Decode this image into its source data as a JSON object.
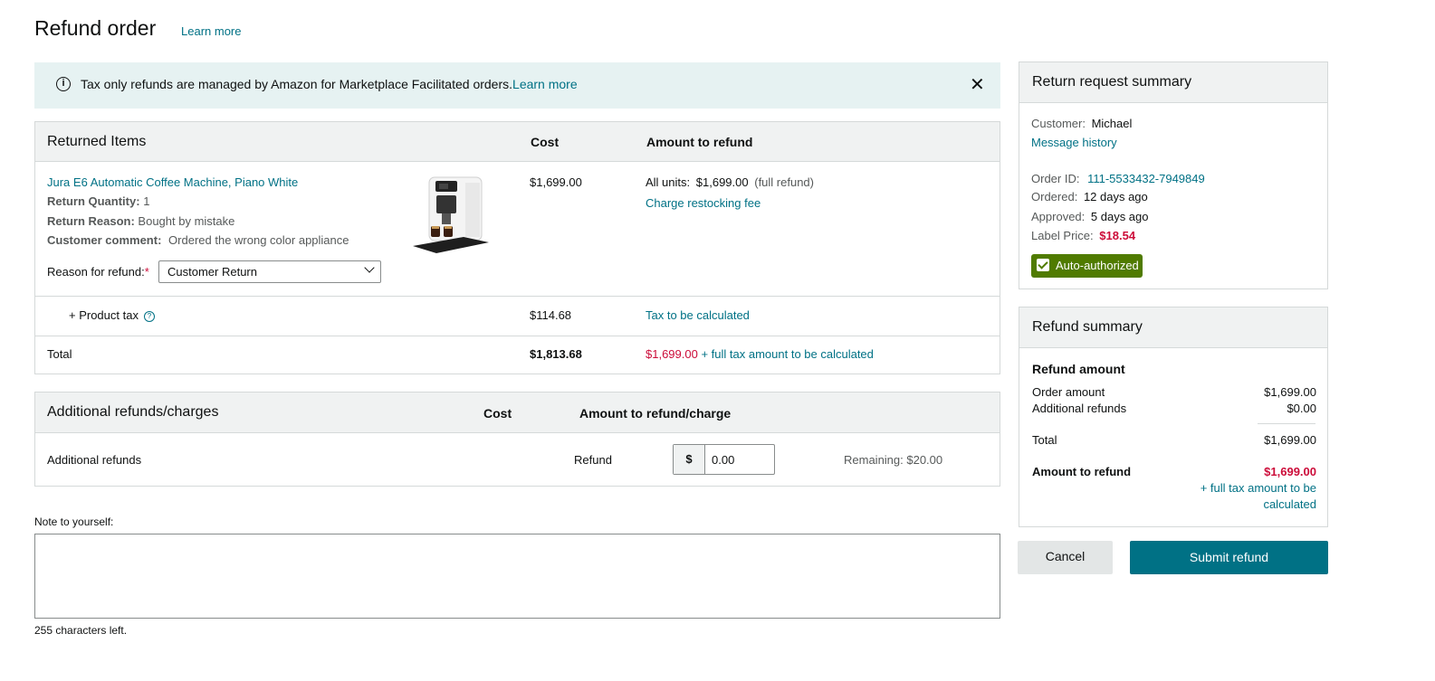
{
  "header": {
    "title": "Refund order",
    "learn_more": "Learn more"
  },
  "banner": {
    "message": "Tax only refunds are managed by Amazon for Marketplace Facilitated orders.",
    "link": "Learn more",
    "close": "✕"
  },
  "returned_items": {
    "title": "Returned Items",
    "col_cost": "Cost",
    "col_amount": "Amount to refund",
    "item": {
      "name": "Jura E6 Automatic Coffee Machine, Piano White",
      "qty_label": "Return Quantity:",
      "qty": "1",
      "reason_label": "Return Reason:",
      "reason": "Bought by mistake",
      "comment_label": "Customer comment:",
      "comment": "Ordered the wrong color appliance",
      "refund_reason_label": "Reason for refund:",
      "required_mark": "*",
      "refund_reason_value": "Customer Return",
      "cost": "$1,699.00",
      "all_units_label": "All units:",
      "all_units_value": "$1,699.00",
      "full_refund": "(full refund)",
      "restocking": "Charge restocking fee"
    },
    "tax": {
      "label": "+ Product tax",
      "cost": "$114.68",
      "amount": "Tax to be calculated"
    },
    "total": {
      "label": "Total",
      "cost": "$1,813.68",
      "amount": "$1,699.00",
      "amount_note": "+ full tax amount to be calculated"
    }
  },
  "additional": {
    "title": "Additional refunds/charges",
    "col_cost": "Cost",
    "col_amount": "Amount to refund/charge",
    "row_label": "Additional refunds",
    "type": "Refund",
    "currency": "$",
    "value": "0.00",
    "remaining": "Remaining: $20.00"
  },
  "note": {
    "label": "Note to yourself:",
    "chars_left": "255 characters left."
  },
  "return_summary": {
    "title": "Return request summary",
    "customer_label": "Customer:",
    "customer": "Michael",
    "message_history": "Message history",
    "order_id_label": "Order ID:",
    "order_id": "111-5533432-7949849",
    "ordered_label": "Ordered:",
    "ordered": "12 days ago",
    "approved_label": "Approved:",
    "approved": "5 days ago",
    "label_price_label": "Label Price:",
    "label_price": "$18.54",
    "badge": "Auto-authorized"
  },
  "refund_summary": {
    "title": "Refund summary",
    "section": "Refund amount",
    "order_amount_label": "Order amount",
    "order_amount": "$1,699.00",
    "additional_label": "Additional refunds",
    "additional": "$0.00",
    "total_label": "Total",
    "total": "$1,699.00",
    "amount_label": "Amount to refund",
    "amount": "$1,699.00",
    "tax_note_1": "+ full tax amount to be",
    "tax_note_2": "calculated"
  },
  "actions": {
    "cancel": "Cancel",
    "submit": "Submit refund"
  },
  "colors": {
    "link": "#007185",
    "alert_red": "#cc0c39",
    "badge_green": "#507b00",
    "banner_bg": "#e6f2f2"
  }
}
